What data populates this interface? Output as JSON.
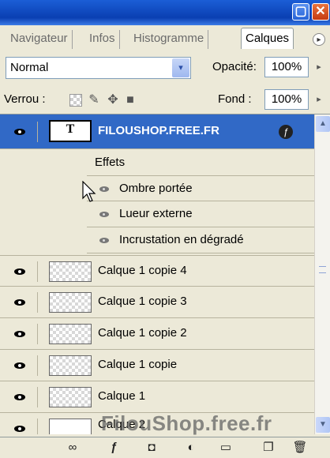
{
  "window": {
    "minimize_glyph": "▢",
    "close_glyph": "✕",
    "accent_color": "#0a3fb2"
  },
  "tabs": [
    {
      "label": "Navigateur",
      "active": false
    },
    {
      "label": "Infos",
      "active": false
    },
    {
      "label": "Histogramme",
      "active": false
    },
    {
      "label": "Calques",
      "active": true
    }
  ],
  "tab_menu_glyph": "▸",
  "blend": {
    "mode": "Normal",
    "dropdown_glyph": "▾",
    "opacity_label": "Opacité:",
    "opacity_value": "100%",
    "arrow_glyph": "▸"
  },
  "lock": {
    "label": "Verrou :",
    "icons": [
      "lock-transparent-icon",
      "brush-icon",
      "move-icon",
      "padlock-icon"
    ],
    "fill_label": "Fond :",
    "fill_value": "100%"
  },
  "layers": {
    "text_layer": {
      "name": "FILOUSHOP.FREE.FR",
      "thumb_glyph": "T",
      "fx_glyph": "ƒ",
      "selected": true,
      "effects_label": "Effets",
      "effects": [
        "Ombre portée",
        "Lueur externe",
        "Incrustation en dégradé"
      ]
    },
    "items": [
      "Calque 1 copie 4",
      "Calque 1 copie 3",
      "Calque 1 copie 2",
      "Calque 1 copie",
      "Calque 1",
      "Calque 2"
    ]
  },
  "scrollbar": {
    "up_glyph": "▲",
    "down_glyph": "▼"
  },
  "watermark": "FilouShop.free.fr",
  "toolbar": {
    "link_glyph": "∞",
    "fx_glyph": "ƒ",
    "mask_glyph": "◘",
    "adjust_glyph": "◐",
    "folder_glyph": "▭",
    "new_glyph": "❐",
    "delete_glyph": "🗑"
  }
}
